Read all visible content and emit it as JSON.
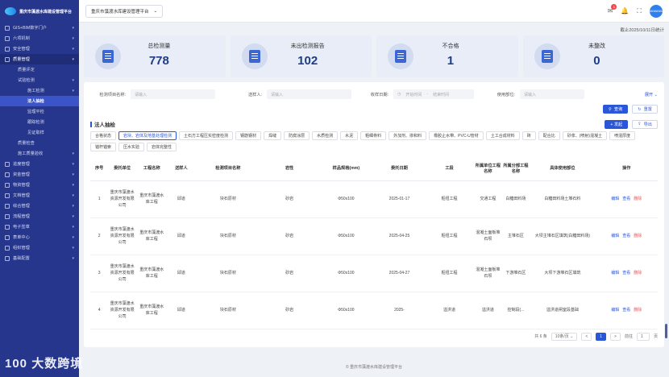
{
  "app": {
    "logo_text": "重庆市藻渡水库建设管理平台"
  },
  "topbar": {
    "project": "重庆市藻渡水库建设管理平台",
    "badge_count": "1",
    "avatar_text": "WAIWAIWAI"
  },
  "sidebar": {
    "items": [
      {
        "label": "GIS+BIM数字门户",
        "level": 0,
        "chev": true
      },
      {
        "label": "六项机制",
        "level": 0,
        "chev": true
      },
      {
        "label": "安全管理",
        "level": 0,
        "chev": true
      },
      {
        "label": "质量管理",
        "level": 0,
        "chev": true,
        "state": "active"
      },
      {
        "label": "质量评定",
        "level": 1
      },
      {
        "label": "试验检测",
        "level": 1,
        "chev": true
      },
      {
        "label": "施工检测",
        "level": 2,
        "chev": true
      },
      {
        "label": "法人抽检",
        "level": 2,
        "state": "sel"
      },
      {
        "label": "监理平检",
        "level": 2
      },
      {
        "label": "跟踪检测",
        "level": 2
      },
      {
        "label": "见证取样",
        "level": 2
      },
      {
        "label": "质量检查",
        "level": 1
      },
      {
        "label": "施工质量验收",
        "level": 1,
        "chev": true
      },
      {
        "label": "进度管理",
        "level": 0,
        "chev": true
      },
      {
        "label": "资金管理",
        "level": 0,
        "chev": true
      },
      {
        "label": "物资管理",
        "level": 0,
        "chev": true
      },
      {
        "label": "文档管理",
        "level": 0,
        "chev": true
      },
      {
        "label": "综合管理",
        "level": 0,
        "chev": true
      },
      {
        "label": "流程管理",
        "level": 0,
        "chev": true
      },
      {
        "label": "电子签章",
        "level": 0,
        "chev": true
      },
      {
        "label": "表单中心",
        "level": 0,
        "chev": true
      },
      {
        "label": "组织管理",
        "level": 0,
        "chev": true
      },
      {
        "label": "基础配置",
        "level": 0,
        "chev": true
      }
    ]
  },
  "stats": {
    "date_label": "截止2025/10/11日统计",
    "cards": [
      {
        "label": "总检测量",
        "value": "778"
      },
      {
        "label": "未出检测报告",
        "value": "102"
      },
      {
        "label": "不合格",
        "value": "1"
      },
      {
        "label": "未整改",
        "value": "0"
      }
    ]
  },
  "filters": {
    "item_label": "检测项目名称:",
    "item_ph": "请输入",
    "sender_label": "送样人:",
    "sender_ph": "请输入",
    "date_label": "收样日期:",
    "date_start": "开始时间",
    "date_sep": "-",
    "date_end": "结束时间",
    "dept_label": "使用部位:",
    "dept_ph": "请输入",
    "expand": "展开",
    "query": "查询",
    "reset": "重置"
  },
  "section": {
    "title": "法人抽检",
    "add": "+ 发起",
    "export": "导出"
  },
  "tags": [
    "合格状态",
    "岩块、岩体及地基处理检测",
    "土石方工程压实密度检测",
    "钢筋钢材",
    "焊缝",
    "防腐涂层",
    "水质检测",
    "水泥",
    "粗细骨料",
    "外加剂、掺和料",
    "橡胶止水带、PVC-U管材",
    "土工合成材料",
    "砖",
    "配合比",
    "砂浆、(喷射)混凝土",
    "喷混厚度",
    "锚杆锚索",
    "压水实验",
    "岩体完整性"
  ],
  "table": {
    "headers": [
      "序号",
      "委托单位",
      "工程名称",
      "送样人",
      "检测项目名称",
      "岩性",
      "样品规格(mm)",
      "委托日期",
      "工段",
      "所属单位工程名称",
      "所属分部工程名称",
      "具体使用部位",
      "操作"
    ],
    "rows": [
      [
        "1",
        "重庆市藻渡水资源开发有限公司",
        "重庆市藻渡水库工程",
        "邱道",
        "块石原材",
        "砂岩",
        "Φ50x100",
        "2025-01-17",
        "枢纽工程",
        "交通工程",
        "白糖田料场",
        "白糖田料场土堆石料",
        "编辑",
        "查看",
        "删除"
      ],
      [
        "2",
        "重庆市藻渡水资源开发有限公司",
        "重庆市藻渡水库工程",
        "邱道",
        "块石原材",
        "砂岩",
        "Φ50x100",
        "2025-04-25",
        "枢纽工程",
        "混凝土面板堆石坝",
        "主堆石区",
        "大坝主堆石区填筑(白糖田料场)",
        "编辑",
        "查看",
        "删除"
      ],
      [
        "3",
        "重庆市藻渡水资源开发有限公司",
        "重庆市藻渡水库工程",
        "邱道",
        "块石原材",
        "砂岩",
        "Φ50x100",
        "2025-04-27",
        "枢纽工程",
        "混凝土面板堆石坝",
        "下游堆石区",
        "大坝下游堆石区填筑",
        "编辑",
        "查看",
        "删除"
      ],
      [
        "4",
        "重庆市藻渡水资源开发有限公司",
        "重庆市藻渡水库工程",
        "邱道",
        "块石原材",
        "砂岩",
        "Φ50x100",
        "2025-",
        "溢洪道",
        "溢洪道",
        "控制段(...",
        "溢洪道闸室段基础",
        "编辑",
        "查看",
        "删除"
      ]
    ]
  },
  "pager": {
    "total": "共 6 条",
    "per_page": "10条/页",
    "prev": "<",
    "page": "1",
    "next": ">",
    "goto": "前往",
    "goto_val": "1",
    "unit": "页"
  },
  "footer": "© 重庆市藻渡水库建设管理平台",
  "watermark": "100 大数跨境"
}
